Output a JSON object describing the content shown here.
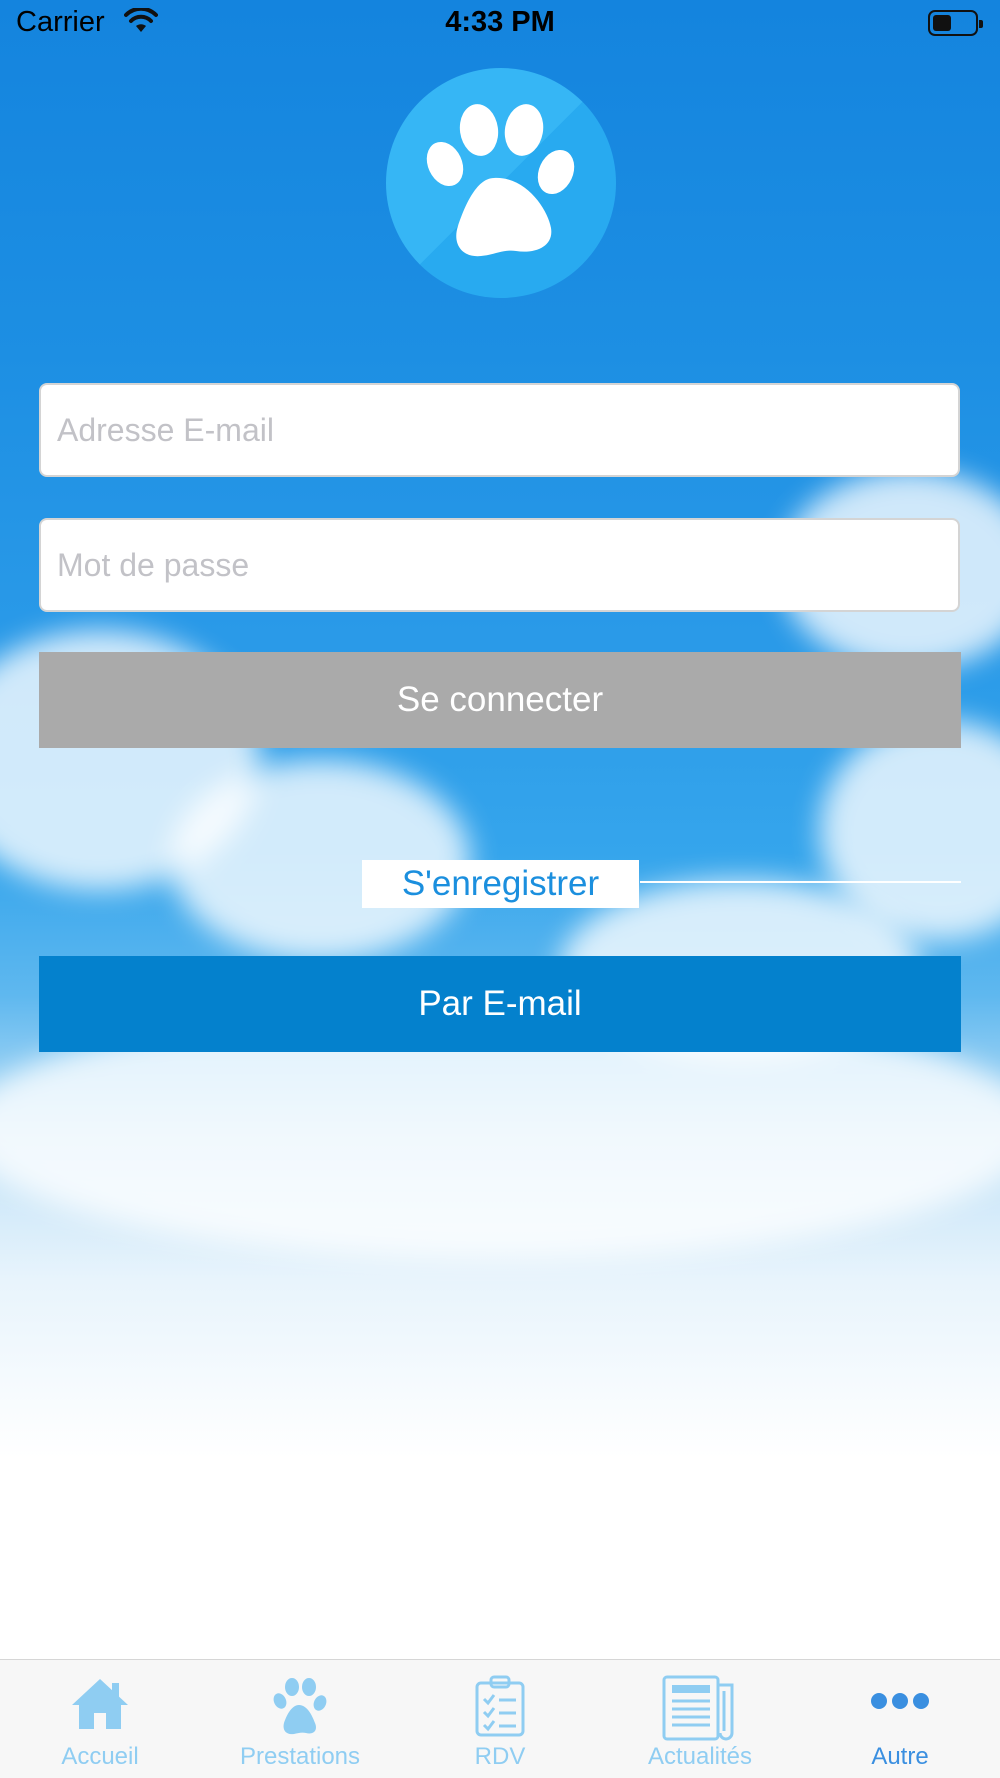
{
  "status_bar": {
    "carrier": "Carrier",
    "time": "4:33 PM",
    "battery_level": 0.45
  },
  "login": {
    "email_placeholder": "Adresse E-mail",
    "password_placeholder": "Mot de passe",
    "submit_label": "Se connecter"
  },
  "register": {
    "heading": "S'enregistrer",
    "email_button_label": "Par E-mail"
  },
  "tabbar": {
    "items": [
      {
        "label": "Accueil",
        "icon": "home-icon",
        "active": false
      },
      {
        "label": "Prestations",
        "icon": "paw-icon",
        "active": false
      },
      {
        "label": "RDV",
        "icon": "clipboard-checklist-icon",
        "active": false
      },
      {
        "label": "Actualités",
        "icon": "newspaper-icon",
        "active": false
      },
      {
        "label": "Autre",
        "icon": "more-dots-icon",
        "active": true
      }
    ]
  },
  "colors": {
    "primary_button": "#0481cd",
    "disabled_button": "#aaaaaa",
    "register_text": "#1b8fde",
    "tab_inactive": "#8fcdf2",
    "tab_active": "#3a8fe0"
  }
}
